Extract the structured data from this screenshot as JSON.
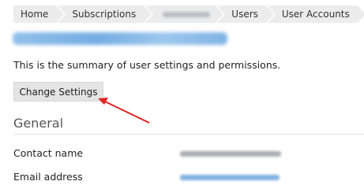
{
  "breadcrumb": {
    "items": [
      {
        "label": "Home"
      },
      {
        "label": "Subscriptions"
      },
      {
        "label": ""
      },
      {
        "label": "Users"
      },
      {
        "label": "User Accounts"
      }
    ]
  },
  "page": {
    "title": "",
    "intro": "This is the summary of user settings and permissions."
  },
  "actions": {
    "change_settings_label": "Change Settings"
  },
  "general": {
    "heading": "General",
    "rows": [
      {
        "label": "Contact name",
        "value": ""
      },
      {
        "label": "Email address",
        "value": ""
      }
    ]
  },
  "colors": {
    "breadcrumb_bg": "#ececec",
    "link_blue": "#4a90d9",
    "annotation_arrow": "#e02424"
  }
}
